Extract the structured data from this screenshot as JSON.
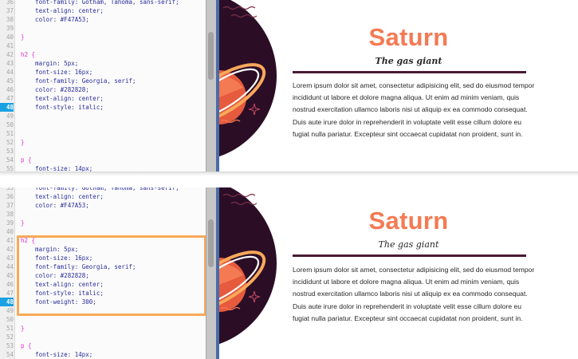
{
  "panels": {
    "top": {
      "editor": {
        "lines": [
          {
            "n": "36",
            "text": "    font-family: Gotham, Tahoma, sans-serif;",
            "kind": "prop"
          },
          {
            "n": "37",
            "text": "    text-align: center;",
            "kind": "prop"
          },
          {
            "n": "38",
            "text": "    color: #F47A53;",
            "kind": "prop"
          },
          {
            "n": "39",
            "text": "",
            "kind": "blank"
          },
          {
            "n": "40",
            "text": "}",
            "kind": "brace"
          },
          {
            "n": "41",
            "text": "",
            "kind": "blank"
          },
          {
            "n": "42",
            "text": "h2 {",
            "kind": "sel"
          },
          {
            "n": "43",
            "text": "    margin: 5px;",
            "kind": "prop"
          },
          {
            "n": "44",
            "text": "    font-size: 16px;",
            "kind": "prop"
          },
          {
            "n": "45",
            "text": "    font-family: Georgia, serif;",
            "kind": "prop"
          },
          {
            "n": "46",
            "text": "    color: #282828;",
            "kind": "prop"
          },
          {
            "n": "47",
            "text": "    text-align: center;",
            "kind": "prop"
          },
          {
            "n": "48",
            "text": "    font-style: italic;",
            "kind": "prop"
          },
          {
            "n": "49",
            "text": "",
            "kind": "blank"
          },
          {
            "n": "50",
            "text": "",
            "kind": "blank"
          },
          {
            "n": "51",
            "text": "",
            "kind": "blank"
          },
          {
            "n": "52",
            "text": "}",
            "kind": "brace"
          },
          {
            "n": "53",
            "text": "",
            "kind": "blank"
          },
          {
            "n": "54",
            "text": "p {",
            "kind": "sel"
          },
          {
            "n": "55",
            "text": "    font-size: 14px;",
            "kind": "prop"
          }
        ],
        "active_line": "48"
      },
      "preview": {
        "title": "Saturn",
        "subtitle": "The gas giant",
        "body": "Lorem ipsum dolor sit amet, consectetur adipisicing elit, sed do eiusmod tempor incididunt ut labore et dolore magna aliqua. Ut enim ad minim veniam, quis nostrud exercitation ullamco laboris nisi ut aliquip ex ea commodo consequat. Duis aute irure dolor in reprehenderit in voluptate velit esse cillum dolore eu fugiat nulla pariatur. Excepteur sint occaecat cupidatat non proident, sunt in."
      }
    },
    "bottom": {
      "editor": {
        "lines": [
          {
            "n": "35",
            "text": "    font-family: Gotham, Tahoma, sans-serif;",
            "kind": "prop"
          },
          {
            "n": "36",
            "text": "    text-align: center;",
            "kind": "prop"
          },
          {
            "n": "37",
            "text": "    color: #F47A53;",
            "kind": "prop"
          },
          {
            "n": "38",
            "text": "",
            "kind": "blank"
          },
          {
            "n": "39",
            "text": "}",
            "kind": "brace"
          },
          {
            "n": "40",
            "text": "",
            "kind": "blank"
          },
          {
            "n": "41",
            "text": "h2 {",
            "kind": "sel"
          },
          {
            "n": "42",
            "text": "    margin: 5px;",
            "kind": "prop"
          },
          {
            "n": "43",
            "text": "    font-size: 16px;",
            "kind": "prop"
          },
          {
            "n": "44",
            "text": "    font-family: Georgia, serif;",
            "kind": "prop"
          },
          {
            "n": "45",
            "text": "    color: #282828;",
            "kind": "prop"
          },
          {
            "n": "46",
            "text": "    text-align: center;",
            "kind": "prop"
          },
          {
            "n": "47",
            "text": "    font-style: italic;",
            "kind": "prop"
          },
          {
            "n": "48",
            "text": "    font-weight: 300;",
            "kind": "prop"
          },
          {
            "n": "49",
            "text": "",
            "kind": "blank"
          },
          {
            "n": "50",
            "text": "",
            "kind": "blank"
          },
          {
            "n": "51",
            "text": "}",
            "kind": "brace"
          },
          {
            "n": "52",
            "text": "",
            "kind": "blank"
          },
          {
            "n": "53",
            "text": "p {",
            "kind": "sel"
          },
          {
            "n": "54",
            "text": "    font-size: 14px;",
            "kind": "prop"
          }
        ],
        "active_line": "48"
      },
      "preview": {
        "title": "Saturn",
        "subtitle": "The gas giant",
        "body": "Lorem ipsum dolor sit amet, consectetur adipisicing elit, sed do eiusmod tempor incididunt ut labore et dolore magna aliqua. Ut enim ad minim veniam, quis nostrud exercitation ullamco laboris nisi ut aliquip ex ea commodo consequat. Duis aute irure dolor in reprehenderit in voluptate velit esse cillum dolore eu fugiat nulla pariatur. Excepteur sint occaecat cupidatat non proident, sunt in."
      }
    }
  },
  "colors": {
    "title": "#F47A53",
    "rule": "#4A1A34",
    "planet_bg": "#2B0E26",
    "planet_ring": "#F9A85A",
    "highlight": "#F9A85A",
    "active_line": "#1BA1E2"
  },
  "icons": [
    "saturn-illustration",
    "sparkle-icon"
  ]
}
